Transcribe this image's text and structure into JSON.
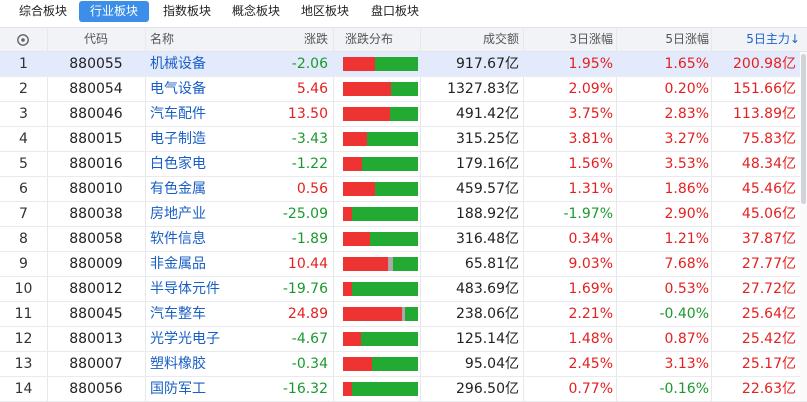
{
  "tabs": [
    {
      "label": "综合板块",
      "active": false
    },
    {
      "label": "行业板块",
      "active": true
    },
    {
      "label": "指数板块",
      "active": false
    },
    {
      "label": "概念板块",
      "active": false
    },
    {
      "label": "地区板块",
      "active": false
    },
    {
      "label": "盘口板块",
      "active": false
    }
  ],
  "columns": {
    "settings_icon": "settings-icon",
    "code": "代码",
    "name": "名称",
    "change": "涨跌",
    "distribution": "涨跌分布",
    "amount": "成交额",
    "rise3": "3日涨幅",
    "rise5": "5日涨幅",
    "main5": "5日主力↓"
  },
  "colors": {
    "up": "#e62020",
    "down": "#1a9a2e",
    "flat": "#aaaaaa",
    "accent": "#3d8ee8"
  },
  "rows": [
    {
      "idx": "1",
      "code": "880055",
      "name": "机械设备",
      "change": "-2.06",
      "dist": [
        0.43,
        0,
        0.57
      ],
      "amount": "917.67亿",
      "r3": "1.95%",
      "r5": "1.65%",
      "m5": "200.98亿",
      "selected": true
    },
    {
      "idx": "2",
      "code": "880054",
      "name": "电气设备",
      "change": "5.46",
      "dist": [
        0.64,
        0,
        0.36
      ],
      "amount": "1327.83亿",
      "r3": "2.09%",
      "r5": "0.20%",
      "m5": "151.66亿",
      "selected": false
    },
    {
      "idx": "3",
      "code": "880046",
      "name": "汽车配件",
      "change": "13.50",
      "dist": [
        0.63,
        0,
        0.37
      ],
      "amount": "491.42亿",
      "r3": "3.75%",
      "r5": "2.83%",
      "m5": "113.89亿",
      "selected": false
    },
    {
      "idx": "4",
      "code": "880015",
      "name": "电子制造",
      "change": "-3.43",
      "dist": [
        0.32,
        0,
        0.68
      ],
      "amount": "315.25亿",
      "r3": "3.81%",
      "r5": "3.27%",
      "m5": "75.83亿",
      "selected": false
    },
    {
      "idx": "5",
      "code": "880016",
      "name": "白色家电",
      "change": "-1.22",
      "dist": [
        0.25,
        0,
        0.75
      ],
      "amount": "179.16亿",
      "r3": "1.56%",
      "r5": "3.53%",
      "m5": "48.34亿",
      "selected": false
    },
    {
      "idx": "6",
      "code": "880010",
      "name": "有色金属",
      "change": "0.56",
      "dist": [
        0.43,
        0,
        0.57
      ],
      "amount": "459.57亿",
      "r3": "1.31%",
      "r5": "1.86%",
      "m5": "45.46亿",
      "selected": false
    },
    {
      "idx": "7",
      "code": "880038",
      "name": "房地产业",
      "change": "-25.09",
      "dist": [
        0.12,
        0,
        0.88
      ],
      "amount": "188.92亿",
      "r3": "-1.97%",
      "r5": "2.90%",
      "m5": "45.06亿",
      "selected": false
    },
    {
      "idx": "8",
      "code": "880058",
      "name": "软件信息",
      "change": "-1.89",
      "dist": [
        0.36,
        0,
        0.64
      ],
      "amount": "316.48亿",
      "r3": "0.34%",
      "r5": "1.21%",
      "m5": "37.87亿",
      "selected": false
    },
    {
      "idx": "9",
      "code": "880009",
      "name": "非金属品",
      "change": "10.44",
      "dist": [
        0.6,
        0.07,
        0.33
      ],
      "amount": "65.81亿",
      "r3": "9.03%",
      "r5": "7.68%",
      "m5": "27.77亿",
      "selected": false
    },
    {
      "idx": "10",
      "code": "880012",
      "name": "半导体元件",
      "change": "-19.76",
      "dist": [
        0.12,
        0,
        0.88
      ],
      "amount": "483.69亿",
      "r3": "1.69%",
      "r5": "0.53%",
      "m5": "27.72亿",
      "selected": false
    },
    {
      "idx": "11",
      "code": "880045",
      "name": "汽车整车",
      "change": "24.89",
      "dist": [
        0.78,
        0.04,
        0.18
      ],
      "amount": "238.06亿",
      "r3": "2.21%",
      "r5": "-0.40%",
      "m5": "25.64亿",
      "selected": false
    },
    {
      "idx": "12",
      "code": "880013",
      "name": "光学光电子",
      "change": "-4.67",
      "dist": [
        0.24,
        0,
        0.76
      ],
      "amount": "125.14亿",
      "r3": "1.48%",
      "r5": "0.87%",
      "m5": "25.42亿",
      "selected": false
    },
    {
      "idx": "13",
      "code": "880007",
      "name": "塑料橡胶",
      "change": "-0.34",
      "dist": [
        0.39,
        0,
        0.61
      ],
      "amount": "95.04亿",
      "r3": "2.45%",
      "r5": "3.13%",
      "m5": "25.17亿",
      "selected": false
    },
    {
      "idx": "14",
      "code": "880056",
      "name": "国防军工",
      "change": "-16.32",
      "dist": [
        0.12,
        0,
        0.88
      ],
      "amount": "296.50亿",
      "r3": "0.77%",
      "r5": "-0.16%",
      "m5": "22.63亿",
      "selected": false
    }
  ]
}
